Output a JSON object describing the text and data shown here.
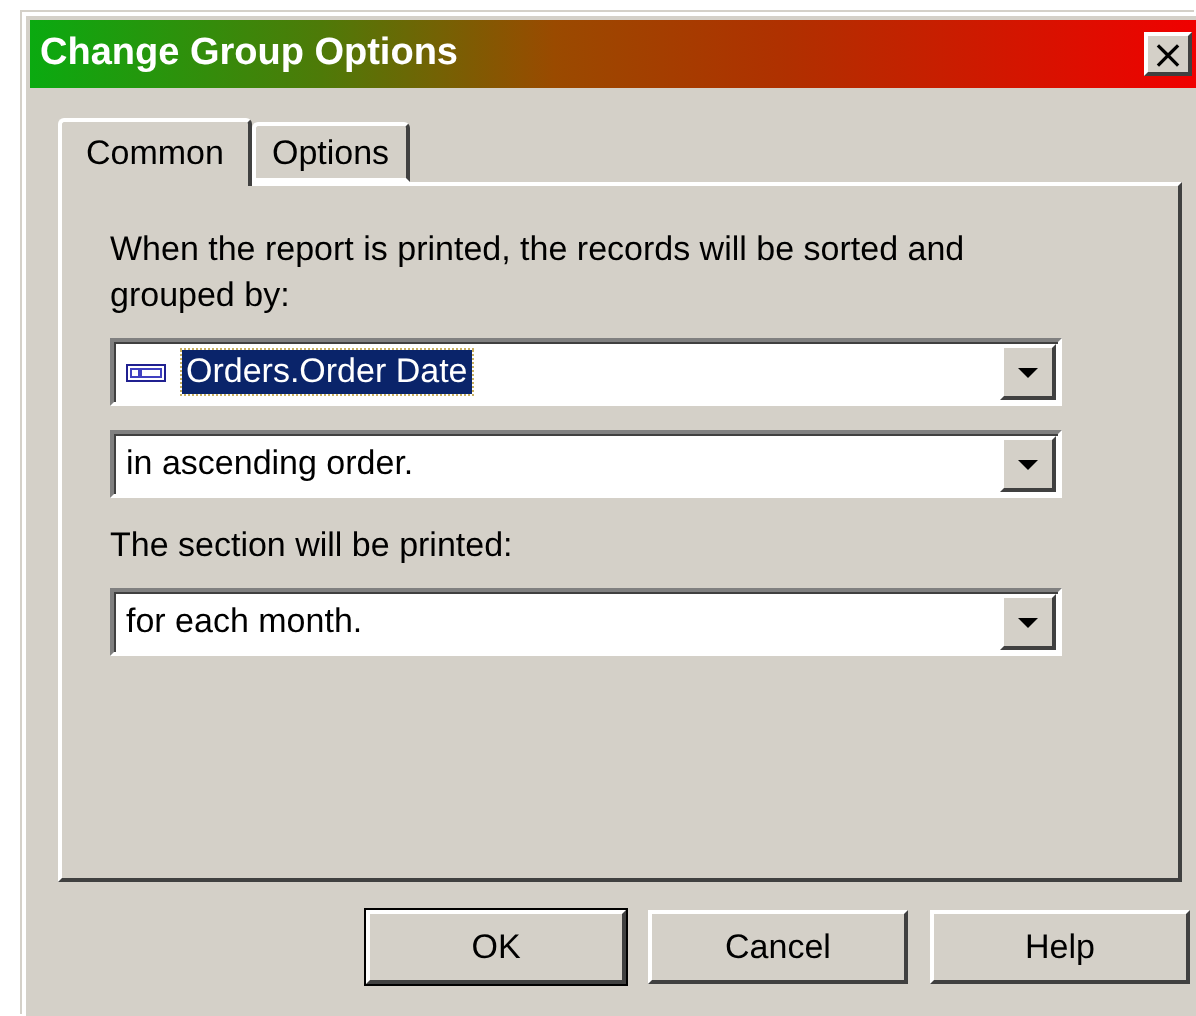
{
  "window": {
    "title": "Change Group Options",
    "close": "×"
  },
  "tabs": [
    {
      "label": "Common",
      "selected": true
    },
    {
      "label": "Options",
      "selected": false
    }
  ],
  "content": [
    {
      "kind": "label",
      "text": "When the report is printed, the records will be sorted and grouped by:"
    },
    {
      "kind": "combo",
      "value": "Orders.Order Date",
      "field_icon": true,
      "focused": true
    },
    {
      "kind": "combo",
      "value": "in ascending order.",
      "field_icon": false,
      "focused": false
    },
    {
      "kind": "label",
      "text": "The section will be printed:"
    },
    {
      "kind": "combo",
      "value": "for each month.",
      "field_icon": false,
      "focused": false
    }
  ],
  "buttons": [
    {
      "label": "OK",
      "default": true
    },
    {
      "label": "Cancel",
      "default": false
    },
    {
      "label": "Help",
      "default": false
    }
  ]
}
